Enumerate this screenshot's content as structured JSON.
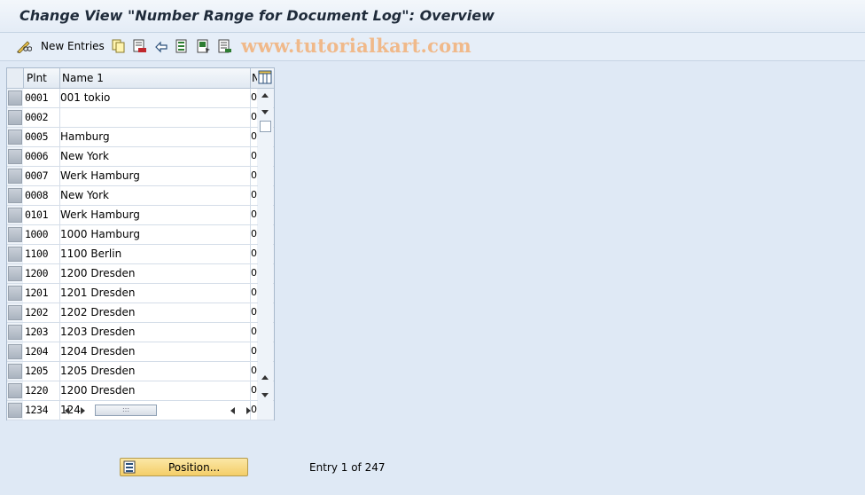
{
  "window": {
    "title": "Change View \"Number Range for Document Log\": Overview"
  },
  "toolbar": {
    "items": [
      {
        "icon": "display-change-icon"
      },
      {
        "label": "New Entries"
      },
      {
        "icon": "copy-icon"
      },
      {
        "icon": "delete-icon"
      },
      {
        "icon": "undo-icon"
      },
      {
        "icon": "select-all-icon"
      },
      {
        "icon": "select-block-icon"
      },
      {
        "icon": "deselect-all-icon"
      }
    ],
    "new_entries_label": "New Entries"
  },
  "watermark": "www.tutorialkart.com",
  "table": {
    "columns": [
      "Plnt",
      "Name 1",
      "N"
    ],
    "rows": [
      {
        "plnt": "0001",
        "name": "001 tokio",
        "n": "0"
      },
      {
        "plnt": "0002",
        "name": "",
        "n": "0"
      },
      {
        "plnt": "0005",
        "name": "Hamburg",
        "n": "0"
      },
      {
        "plnt": "0006",
        "name": "New York",
        "n": "0"
      },
      {
        "plnt": "0007",
        "name": "Werk Hamburg",
        "n": "0"
      },
      {
        "plnt": "0008",
        "name": "New York",
        "n": "0"
      },
      {
        "plnt": "0101",
        "name": "Werk Hamburg",
        "n": "0"
      },
      {
        "plnt": "1000",
        "name": "1000 Hamburg",
        "n": "0"
      },
      {
        "plnt": "1100",
        "name": "1100 Berlin",
        "n": "0"
      },
      {
        "plnt": "1200",
        "name": "1200 Dresden",
        "n": "0"
      },
      {
        "plnt": "1201",
        "name": "1201 Dresden",
        "n": "0"
      },
      {
        "plnt": "1202",
        "name": "1202 Dresden",
        "n": "0"
      },
      {
        "plnt": "1203",
        "name": "1203 Dresden",
        "n": "0"
      },
      {
        "plnt": "1204",
        "name": "1204 Dresden",
        "n": "0"
      },
      {
        "plnt": "1205",
        "name": "1205 Dresden",
        "n": "0"
      },
      {
        "plnt": "1220",
        "name": "1200 Dresden",
        "n": "0"
      },
      {
        "plnt": "1234",
        "name": "124",
        "n": "0"
      }
    ]
  },
  "footer": {
    "position_button_label": "Position...",
    "entry_text": "Entry 1 of 247"
  },
  "colors": {
    "background": "#dfe9f5",
    "button": "#f4ce68",
    "watermark": "#f0b98a"
  }
}
